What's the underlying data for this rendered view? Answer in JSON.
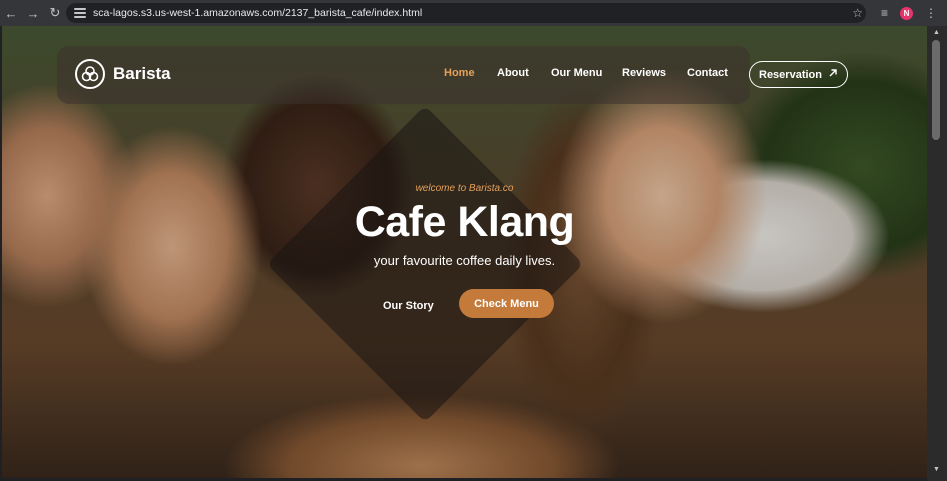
{
  "browser": {
    "url": "sca-lagos.s3.us-west-1.amazonaws.com/2137_barista_cafe/index.html",
    "profile_initial": "N",
    "icons": [
      "back-icon",
      "forward-icon",
      "reload-icon",
      "site-info-icon",
      "bookmark-star-icon",
      "reading-list-icon",
      "profile-avatar",
      "more-menu-icon"
    ]
  },
  "header": {
    "logo_text": "Barista",
    "nav": [
      {
        "label": "Home",
        "active": true
      },
      {
        "label": "About"
      },
      {
        "label": "Our Menu"
      },
      {
        "label": "Reviews"
      },
      {
        "label": "Contact"
      }
    ],
    "reservation_label": "Reservation",
    "reservation_icon": "arrow-up-right-icon"
  },
  "hero": {
    "welcome": "welcome to Barista.co",
    "title": "Cafe Klang",
    "subtitle": "your favourite coffee daily lives.",
    "our_story_label": "Our Story",
    "check_menu_label": "Check Menu"
  },
  "colors": {
    "accent": "#e6a05a",
    "button": "#c47a3a",
    "chrome": "#35363a"
  }
}
